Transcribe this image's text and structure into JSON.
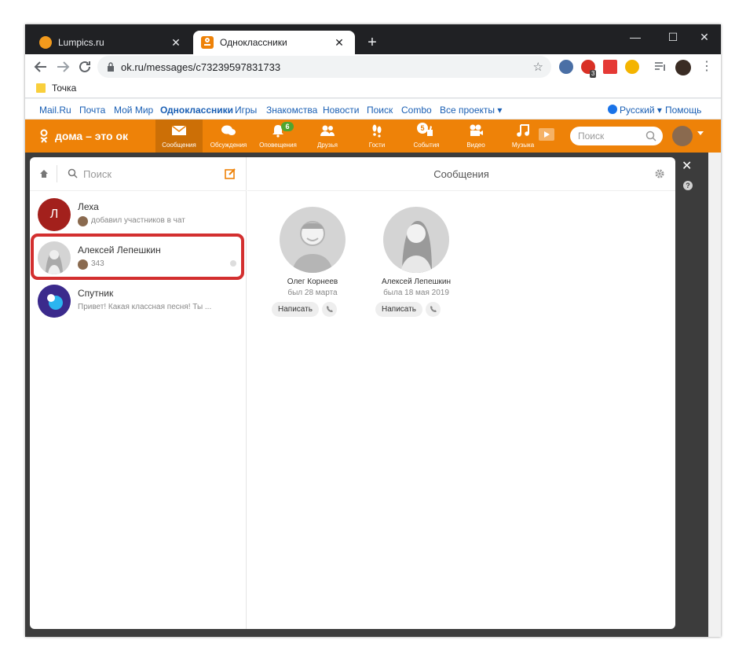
{
  "browser": {
    "tabs": [
      {
        "title": "Lumpics.ru"
      },
      {
        "title": "Одноклассники"
      }
    ],
    "address": "ok.ru/messages/c73239597831733",
    "extension_badge": "3",
    "bookmark": "Точка",
    "window_controls": {
      "minimize": "—",
      "maximize": "☐",
      "close": "✕"
    }
  },
  "portal_bar": {
    "left_links": [
      "Mail.Ru",
      "Почта",
      "Мой Мир",
      "Одноклассники",
      "Игры",
      "Знакомства",
      "Новости",
      "Поиск",
      "Combo",
      "Все проекты ▾"
    ],
    "language": "Русский ▾",
    "help": "Помощь"
  },
  "ok_header": {
    "logo_text": "дома – это ок",
    "nav": [
      {
        "label": "Сообщения",
        "icon": "envelope-icon"
      },
      {
        "label": "Обсуждения",
        "icon": "chat-bubbles-icon"
      },
      {
        "label": "Оповещения",
        "icon": "bell-icon",
        "badge": "6"
      },
      {
        "label": "Друзья",
        "icon": "friends-icon"
      },
      {
        "label": "Гости",
        "icon": "footprints-icon"
      },
      {
        "label": "События",
        "icon": "events-icon",
        "badge": "5"
      },
      {
        "label": "Видео",
        "icon": "video-camera-icon"
      },
      {
        "label": "Музыка",
        "icon": "music-note-icon"
      }
    ],
    "search_placeholder": "Поиск"
  },
  "messages": {
    "search_label": "Поиск",
    "header_title": "Сообщения",
    "chats": [
      {
        "name": "Леха",
        "avatar_letter": "Л",
        "preview": "добавил участников в чат"
      },
      {
        "name": "Алексей Лепешкин",
        "preview": "343"
      },
      {
        "name": "Спутник",
        "preview": "Привет! Какая классная песня! Ты ..."
      }
    ],
    "participants": [
      {
        "name": "Олег Корнеев",
        "seen": "был 28 марта",
        "write": "Написать"
      },
      {
        "name": "Алексей Лепешкин",
        "seen": "была 18 мая 2019",
        "write": "Написать"
      }
    ]
  },
  "colors": {
    "ok_orange": "#ee8208",
    "highlight_red": "#d32f2f",
    "badge_green": "#51a52f"
  }
}
